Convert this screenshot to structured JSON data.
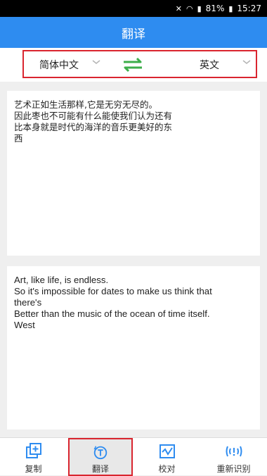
{
  "status": {
    "battery": "81%",
    "time": "15:27"
  },
  "header": {
    "title": "翻译"
  },
  "languages": {
    "source": "简体中文",
    "target": "英文"
  },
  "source_text": {
    "lines": [
      "艺术正如生活那样,它是无穷无尽的。",
      "因此枣也不可能有什么能使我们认为还有",
      "比本身就是时代的海洋的音乐更美好的东",
      "西"
    ]
  },
  "translated_text": {
    "lines": [
      "Art, like life, is endless.",
      "So it's impossible for dates to make us think that",
      "there's",
      "Better than the music of the ocean of time itself.",
      "West"
    ]
  },
  "bottom_nav": {
    "items": [
      {
        "label": "复制",
        "icon": "copy-add-icon"
      },
      {
        "label": "翻译",
        "icon": "translate-icon"
      },
      {
        "label": "校对",
        "icon": "proofread-icon"
      },
      {
        "label": "重新识别",
        "icon": "re-recognize-icon"
      }
    ]
  },
  "colors": {
    "accent": "#2e8cf0",
    "highlight": "#d9252f",
    "swap": "#3cae4a"
  }
}
